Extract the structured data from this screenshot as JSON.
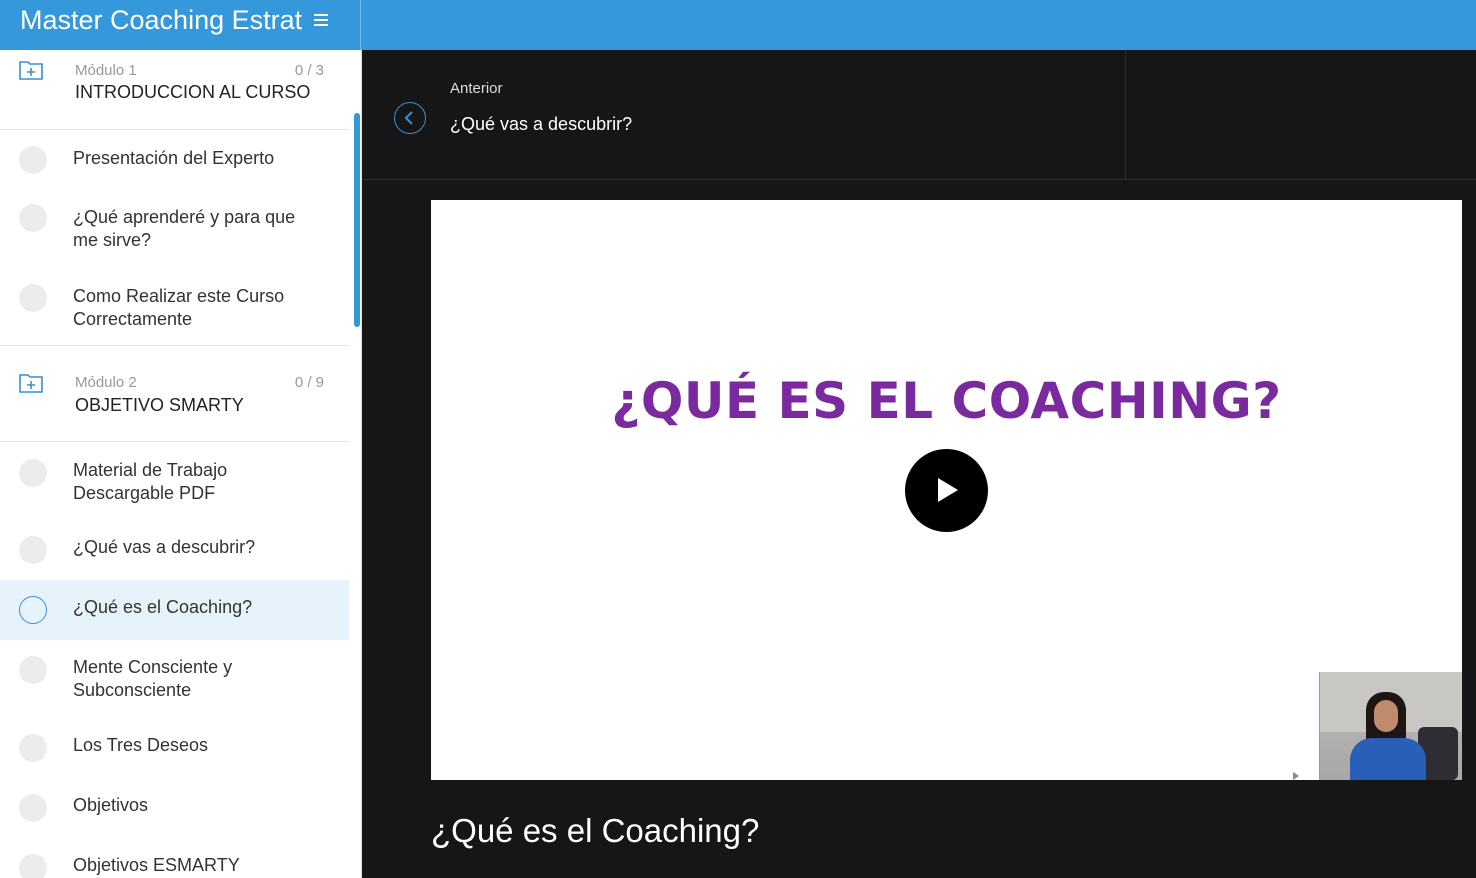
{
  "header": {
    "course_title": "Master Coaching Estrat",
    "accent_color": "#3498db"
  },
  "sidebar": {
    "modules": [
      {
        "number": "Módulo 1",
        "progress": "0 / 3",
        "title": "INTRODUCCION AL CURSO",
        "lessons": [
          "Presentación del Experto",
          "¿Qué aprenderé y para que me sirve?",
          "Como Realizar este Curso Correctamente"
        ]
      },
      {
        "number": "Módulo 2",
        "progress": "0 / 9",
        "title": "OBJETIVO SMARTY",
        "lessons": [
          "Material de Trabajo Descargable PDF",
          "¿Qué vas a descubrir?",
          "¿Qué es el Coaching?",
          "Mente Consciente y Subconsciente",
          "Los Tres Deseos",
          "Objetivos",
          "Objetivos ESMARTY"
        ]
      }
    ],
    "active_lesson": "¿Qué es el Coaching?"
  },
  "nav": {
    "prev_label": "Anterior",
    "prev_title": "¿Qué vas a descubrir?"
  },
  "video": {
    "slide_heading": "¿QUÉ ES EL COACHING?",
    "heading_color": "#7a2a9e"
  },
  "lesson": {
    "title": "¿Qué es el Coaching?"
  }
}
